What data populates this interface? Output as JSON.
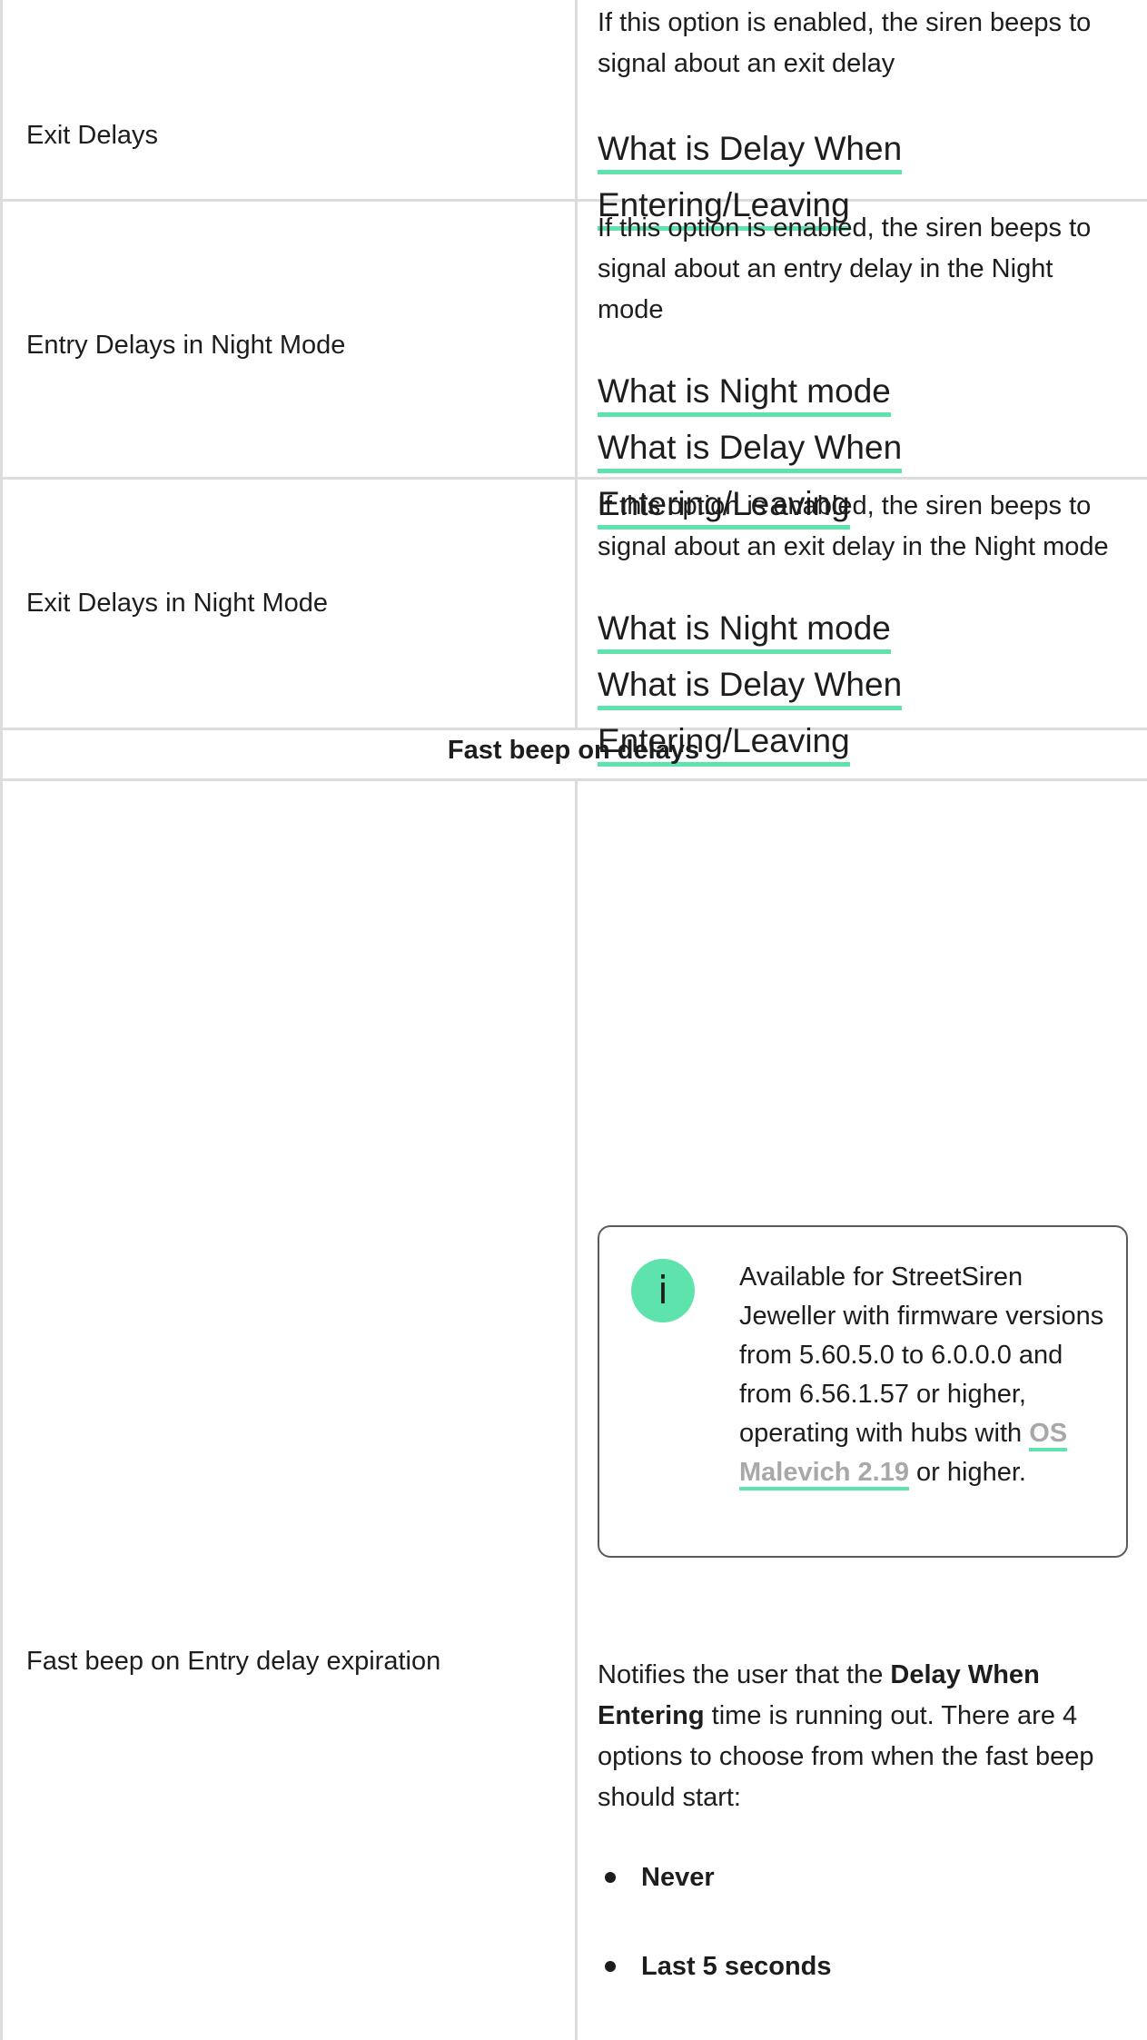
{
  "rows": [
    {
      "label": "Exit Delays",
      "description": "If this option is enabled, the siren beeps to signal about an exit delay",
      "links": [
        "What is Delay When",
        "Entering/Leaving"
      ]
    },
    {
      "label": "Entry Delays in Night Mode",
      "description": "If this option is enabled, the siren beeps to signal about an entry delay in the Night mode",
      "links": [
        "What is Night mode",
        "What is Delay When",
        "Entering/Leaving"
      ]
    },
    {
      "label": "Exit Delays in Night Mode",
      "description": "If this option is enabled, the siren beeps to signal about an exit delay in the Night mode",
      "links": [
        "What is Night mode",
        "What is Delay When",
        "Entering/Leaving"
      ]
    }
  ],
  "section": {
    "title": "Fast beep on delays"
  },
  "fast_beep_row": {
    "label": "Fast beep on Entry delay expiration",
    "note": {
      "icon": "info-icon",
      "icon_glyph": "i",
      "text_before": "Available for StreetSiren Jeweller with firmware versions from 5.60.5.0 to 6.0.0.0 and from 6.56.1.57 or higher, operating with hubs with ",
      "link": "OS Malevich 2.19",
      "text_after": " or higher."
    },
    "desc_part1": "Notifies the user that the ",
    "desc_bold": "Delay When Entering",
    "desc_part2": " time is running out. There are 4 options to choose from when the fast beep should start:",
    "options": [
      "Never",
      "Last 5 seconds"
    ]
  },
  "colors": {
    "accent": "#5fe3ad",
    "border": "#dcdcdc",
    "text": "#1d1d1d",
    "muted_link": "#a8a8a8"
  }
}
